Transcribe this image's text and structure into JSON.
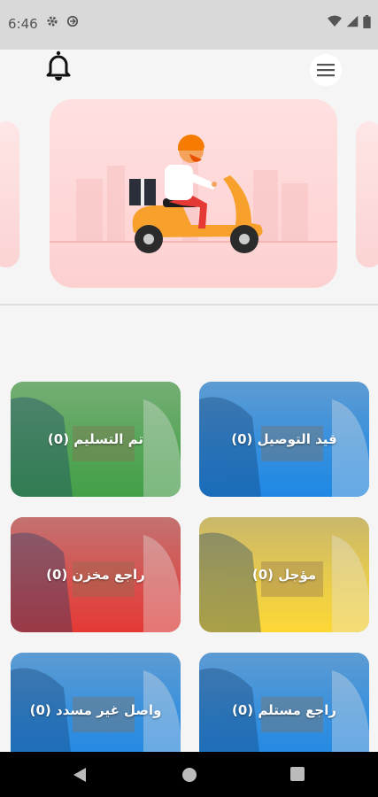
{
  "status_bar": {
    "time": "6:46",
    "left_icons": [
      "gear-icon",
      "sync-icon"
    ],
    "right_icons": [
      "wifi-icon",
      "signal-icon",
      "battery-icon"
    ]
  },
  "header": {
    "icons": [
      "bell-icon",
      "menu-icon"
    ]
  },
  "banner": {
    "illustration": "delivery-scooter"
  },
  "tiles": [
    {
      "label": "قيد التوصيل (0)",
      "color": "#1e88e5"
    },
    {
      "label": "تم التسليم (0)",
      "color": "#43a047"
    },
    {
      "label": "مؤجل (0)",
      "color": "#fdd835"
    },
    {
      "label": "راجع مخزن (0)",
      "color": "#e53935"
    },
    {
      "label": "راجع مستلم (0)",
      "color": "#1e88e5"
    },
    {
      "label": "واصل غير مسدد (0)",
      "color": "#1e88e5"
    }
  ],
  "nav_bar": {
    "icons": [
      "back-icon",
      "home-icon",
      "recents-icon"
    ]
  }
}
